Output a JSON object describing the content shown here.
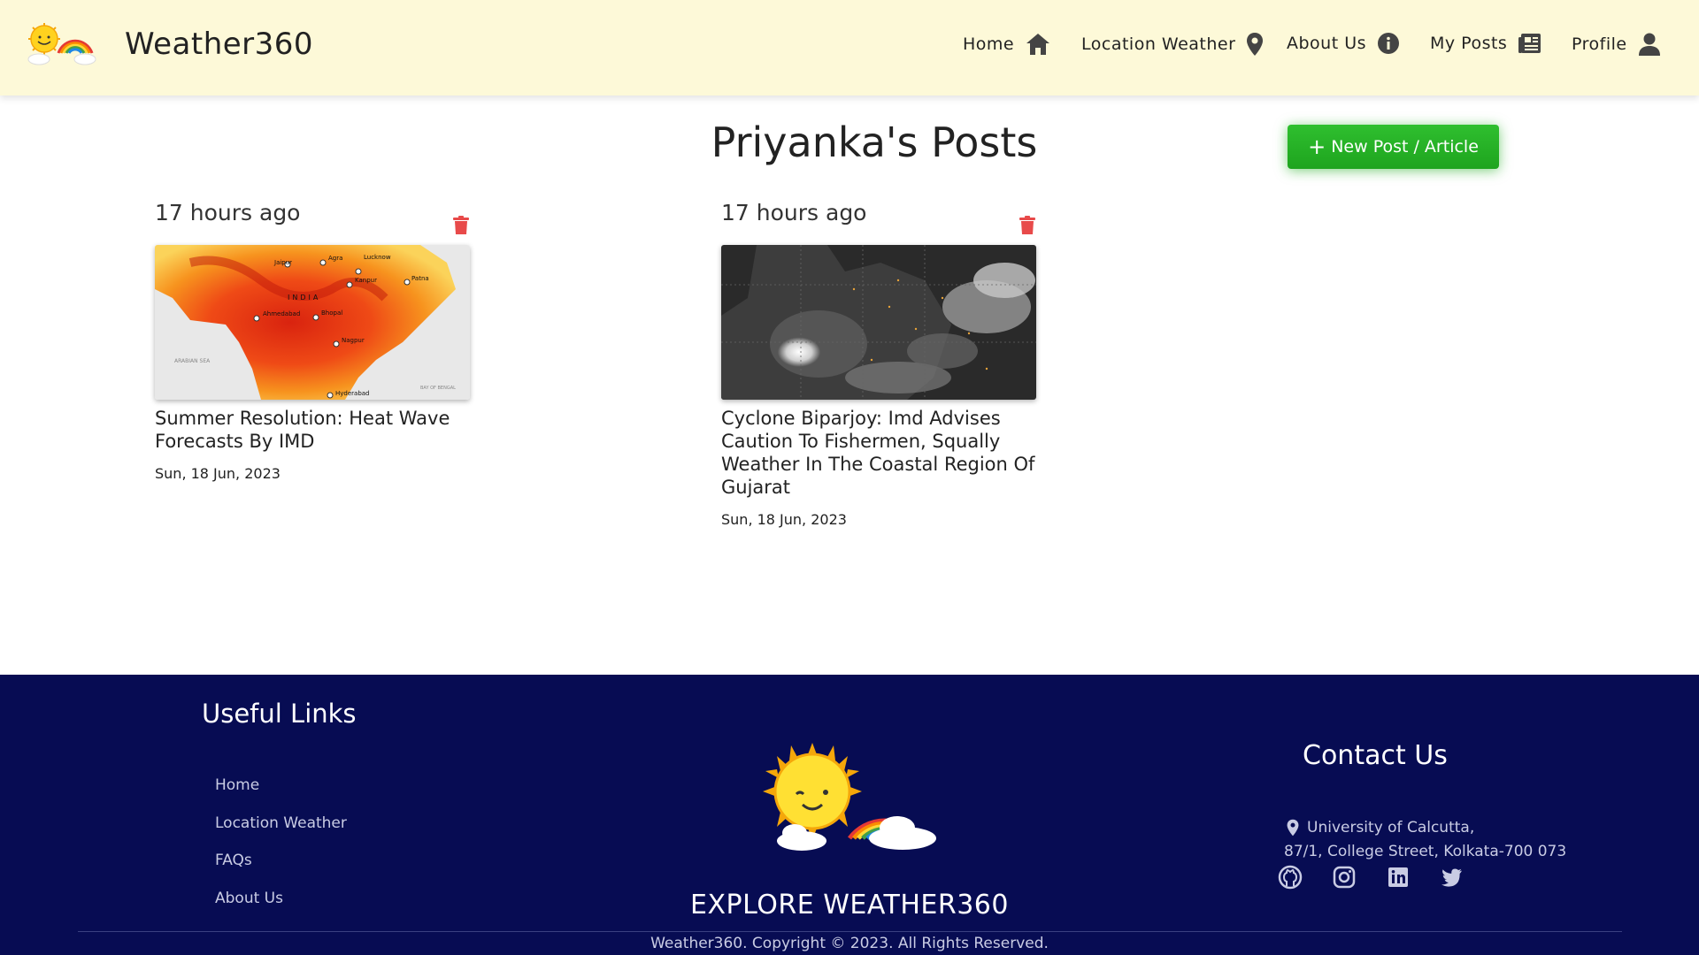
{
  "header": {
    "brand": "Weather360",
    "nav": [
      {
        "label": "Home",
        "icon": "home-icon"
      },
      {
        "label": "Location Weather",
        "icon": "location-pin-icon"
      },
      {
        "label": "About Us",
        "icon": "info-icon"
      },
      {
        "label": "My Posts",
        "icon": "newspaper-icon"
      },
      {
        "label": "Profile",
        "icon": "user-icon"
      }
    ]
  },
  "main": {
    "title": "Priyanka's Posts",
    "new_post_label": "New Post / Article",
    "posts": [
      {
        "time_ago": "17 hours ago",
        "title": "Summer Resolution: Heat Wave Forecasts By IMD",
        "date": "Sun, 18 Jun, 2023",
        "thumb_labels": [
          "Jaipur",
          "Agra",
          "Lucknow",
          "Kanpur",
          "Patna",
          "INDIA",
          "Ahmedabad",
          "Bhopal",
          "Nagpur",
          "ARABIAN SEA",
          "Hyderabad",
          "BAY OF BENGAL"
        ]
      },
      {
        "time_ago": "17 hours ago",
        "title": "Cyclone Biparjoy: Imd Advises Caution To Fishermen, Squally Weather In The Coastal Region Of Gujarat",
        "date": "Sun, 18 Jun, 2023"
      }
    ]
  },
  "footer": {
    "useful_links_title": "Useful Links",
    "links": [
      "Home",
      "Location Weather",
      "FAQs",
      "About Us"
    ],
    "explore": "EXPLORE WEATHER360",
    "contact_title": "Contact Us",
    "address_line1": "University of Calcutta,",
    "address_line2": "87/1, College Street, Kolkata-700 073",
    "social": [
      "github-icon",
      "instagram-icon",
      "linkedin-icon",
      "twitter-icon"
    ],
    "copyright": "Weather360. Copyright © 2023. All Rights Reserved."
  },
  "colors": {
    "header_bg": "#fdf9d8",
    "accent_green": "#22b022",
    "footer_bg": "#070c53",
    "trash_red": "#e84a4a"
  }
}
